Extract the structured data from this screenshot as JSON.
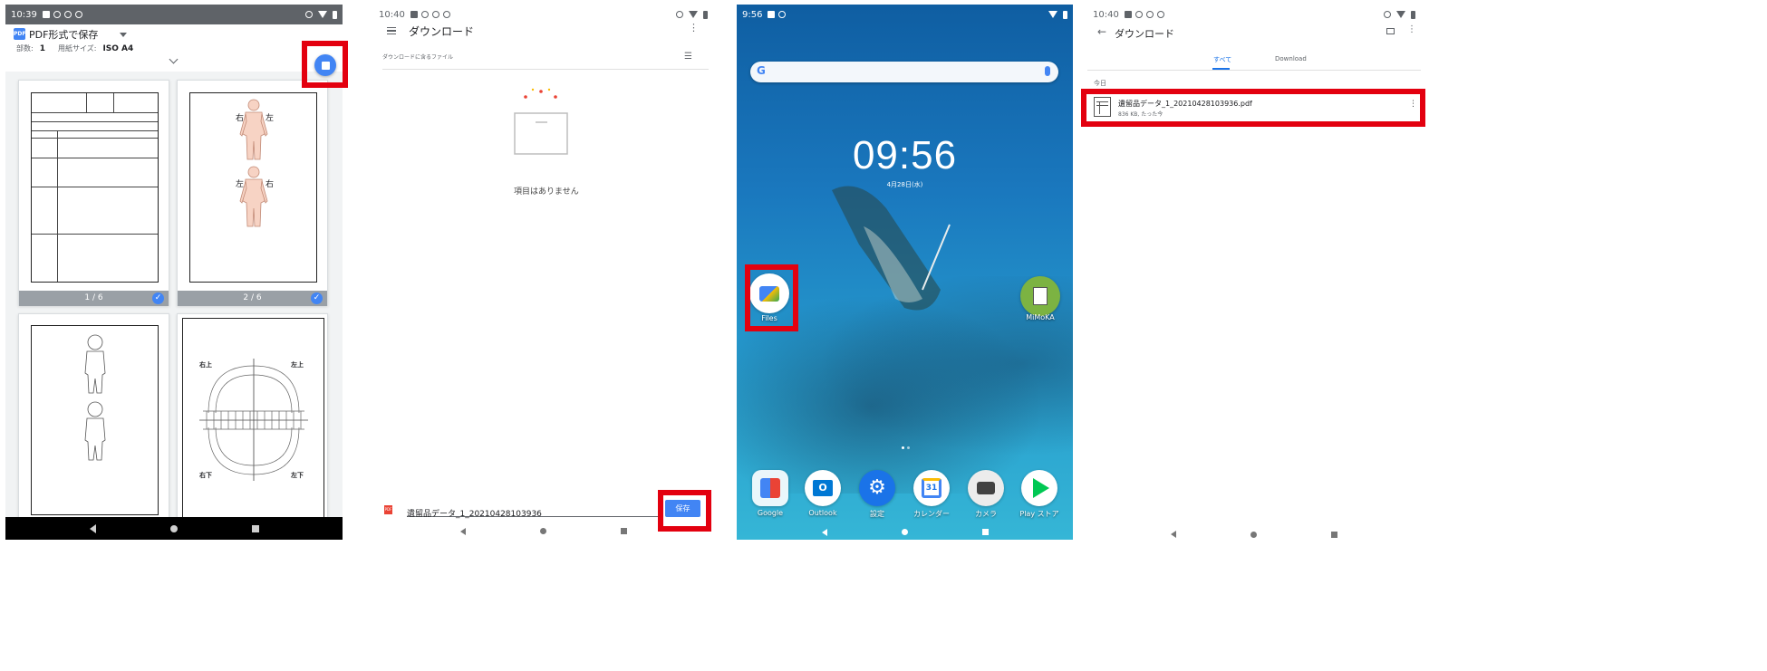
{
  "panel1": {
    "status_time": "10:39",
    "title": "PDF形式で保存",
    "copies_label": "部数:",
    "copies_value": "1",
    "paper_label": "用紙サイズ:",
    "paper_value": "ISO A4",
    "pages": [
      {
        "caption": "1 / 6"
      },
      {
        "caption": "2 / 6"
      },
      {
        "caption": ""
      },
      {
        "caption": ""
      }
    ],
    "body_labels": {
      "right": "右",
      "left": "左"
    },
    "teeth_labels": {
      "upper_right": "右上",
      "upper_left": "左上",
      "lower_right": "右下",
      "lower_left": "左下"
    }
  },
  "panel2": {
    "status_time": "10:40",
    "title": "ダウンロード",
    "subheader": "ダウンロードに含るファイル",
    "empty_text": "項目はありません",
    "filename": "遺留品データ_1_20210428103936",
    "save_label": "保存"
  },
  "panel3": {
    "status_time": "9:56",
    "clock": "09:56",
    "date": "4月28日(水)",
    "files_label": "Files",
    "mimoka_label": "MiMoKA",
    "dock": [
      {
        "label": "Google"
      },
      {
        "label": "Outlook"
      },
      {
        "label": "設定"
      },
      {
        "label": "カレンダー"
      },
      {
        "label": "カメラ"
      },
      {
        "label": "Play ストア"
      }
    ]
  },
  "panel4": {
    "status_time": "10:40",
    "title": "ダウンロード",
    "tab_all": "すべて",
    "tab_download": "Download",
    "section": "今日",
    "file_name": "遺留品データ_1_20210428103936.pdf",
    "file_meta": "836 KB, たった今"
  },
  "colors": {
    "accent_blue": "#4285f4",
    "highlight_red": "#e3000f"
  }
}
